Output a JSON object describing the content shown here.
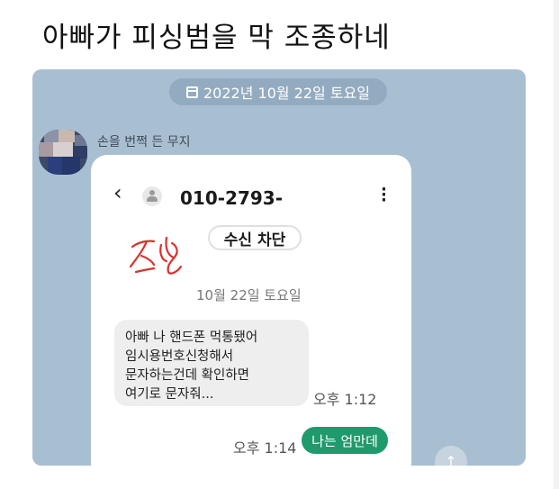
{
  "post": {
    "title": "아빠가 피싱범을 막 조종하네"
  },
  "chat": {
    "date": "2022년 10월 22일 토요일",
    "sender": "손을 번쩍 든 무지",
    "screenshot": {
      "phone_number": "010-2793-",
      "block_button": "수신 차단",
      "date": "10월 22일 토요일",
      "incoming_lines": [
        "아빠 나 핸드폰 먹통됐어",
        "임시용번호신청해서",
        "문자하는건데 확인하면",
        "여기로 문자줘..."
      ],
      "incoming_time": "오후 1:12",
      "outgoing_text": "나는 엄만데",
      "outgoing_time": "오후 1:14"
    }
  },
  "colors": {
    "chat_background": "#a8bfd2",
    "date_pill": "#93abc0",
    "outgoing_bubble": "#1f9a6c",
    "signature_ink": "#d8322e"
  },
  "icons": [
    "calendar-icon",
    "back-arrow-icon",
    "contact-person-icon",
    "more-options-icon",
    "scroll-up-icon"
  ]
}
